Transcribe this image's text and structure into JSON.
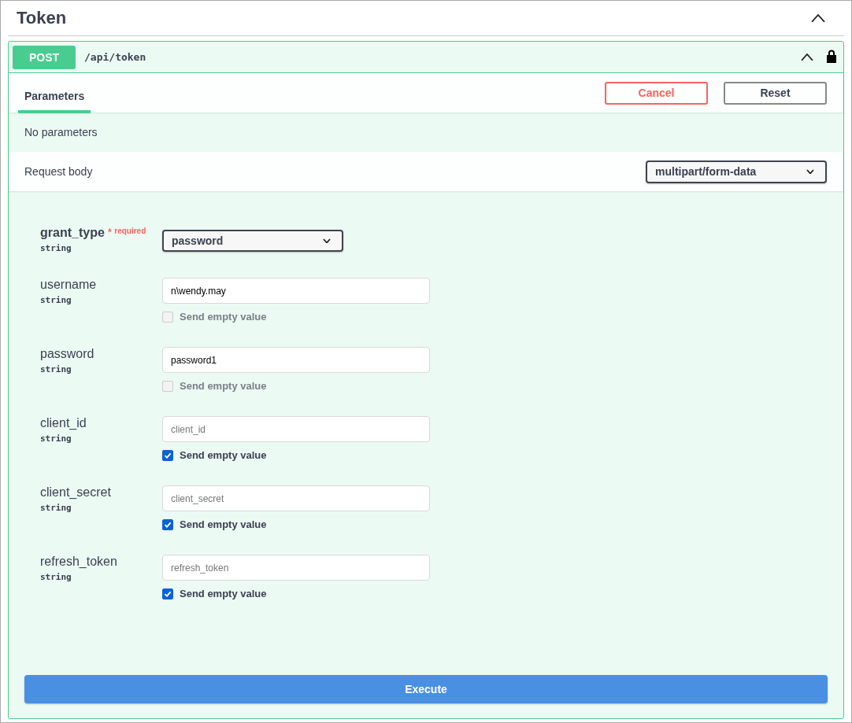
{
  "section": {
    "title": "Token",
    "expanded": true
  },
  "operation": {
    "method": "POST",
    "path": "/api/token",
    "expanded": true,
    "locked": true
  },
  "tabs": [
    {
      "label": "Parameters",
      "selected": true
    }
  ],
  "buttons": [
    {
      "label": "Cancel",
      "kind": "cancel"
    },
    {
      "label": "Reset",
      "kind": "reset"
    }
  ],
  "parameters_message": "No parameters",
  "request_body": {
    "label": "Request body",
    "content_type": "multipart/form-data"
  },
  "fields": [
    {
      "name": "grant_type",
      "required": true,
      "required_mark": "*",
      "required_label": "required",
      "type": "string",
      "kind": "select",
      "value": "password"
    },
    {
      "name": "username",
      "required": false,
      "type": "string",
      "kind": "text",
      "value": "n\\wendy.may",
      "send_empty": {
        "label": "Send empty value",
        "checked": false,
        "disabled": true
      }
    },
    {
      "name": "password",
      "required": false,
      "type": "string",
      "kind": "text",
      "value": "password1",
      "send_empty": {
        "label": "Send empty value",
        "checked": false,
        "disabled": true
      }
    },
    {
      "name": "client_id",
      "required": false,
      "type": "string",
      "kind": "text",
      "placeholder": "client_id",
      "send_empty": {
        "label": "Send empty value",
        "checked": true,
        "disabled": false
      }
    },
    {
      "name": "client_secret",
      "required": false,
      "type": "string",
      "kind": "text",
      "placeholder": "client_secret",
      "send_empty": {
        "label": "Send empty value",
        "checked": true,
        "disabled": false
      }
    },
    {
      "name": "refresh_token",
      "required": false,
      "type": "string",
      "kind": "text",
      "placeholder": "refresh_token",
      "send_empty": {
        "label": "Send empty value",
        "checked": true,
        "disabled": false
      }
    }
  ],
  "execute_button": "Execute"
}
